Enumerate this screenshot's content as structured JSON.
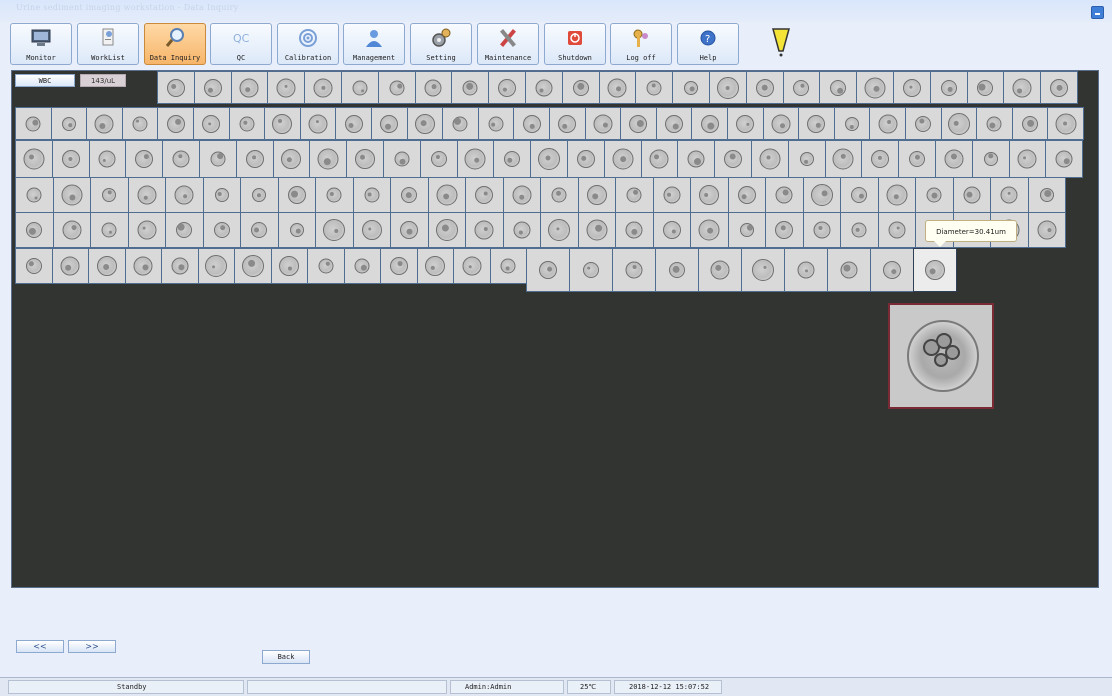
{
  "window": {
    "title": "Urine sediment imaging workstation - Data Inquiry"
  },
  "toolbar": {
    "buttons": [
      {
        "label": "Monitor",
        "icon": "monitor-icon"
      },
      {
        "label": "WorkList",
        "icon": "worklist-icon"
      },
      {
        "label": "Data Inquiry",
        "icon": "magnifier-icon",
        "active": true
      },
      {
        "label": "QC",
        "icon": "qc-icon"
      },
      {
        "label": "Calibration",
        "icon": "target-icon"
      },
      {
        "label": "Management",
        "icon": "user-icon"
      },
      {
        "label": "Setting",
        "icon": "gears-icon"
      },
      {
        "label": "Maintenance",
        "icon": "tools-icon"
      },
      {
        "label": "Shutdown",
        "icon": "power-icon"
      },
      {
        "label": "Log off",
        "icon": "keys-icon"
      },
      {
        "label": "Help",
        "icon": "help-icon"
      }
    ]
  },
  "panel": {
    "category_button": "WBC",
    "count": "143/uL",
    "tooltip": "Diameter=30.41um"
  },
  "nav": {
    "prev": "<<",
    "next": ">>",
    "back": "Back"
  },
  "status": {
    "state": "Standby",
    "user": "Admin:Admin",
    "temperature": "25℃",
    "datetime": "2018-12-12 15:07:52"
  },
  "colors": {
    "panel_bg": "#323431",
    "accent_active": "#f6b56a",
    "button_border": "#8ea9cf"
  }
}
